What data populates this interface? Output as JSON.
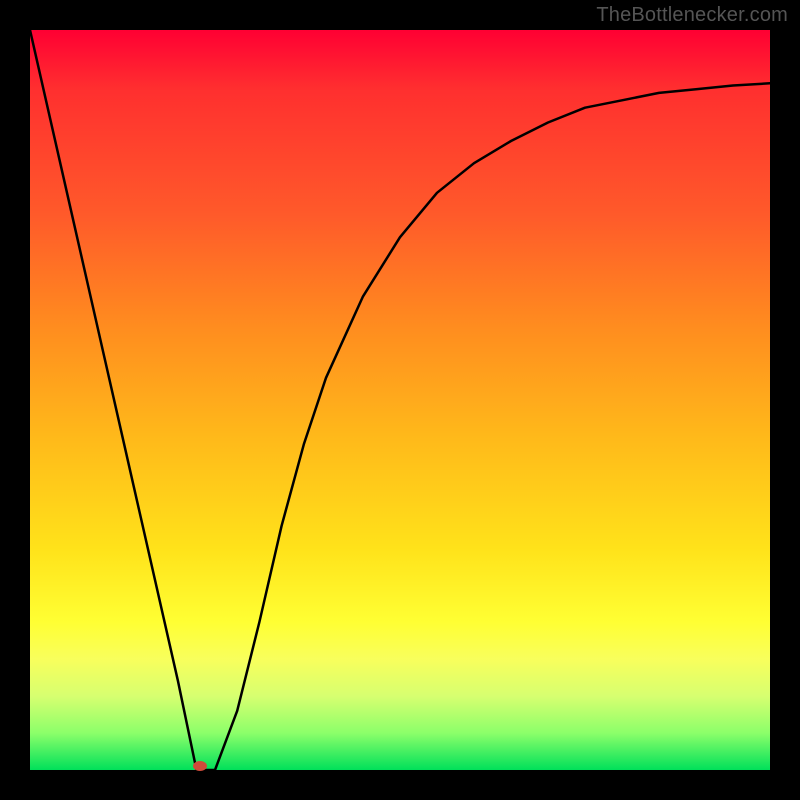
{
  "attribution": "TheBottlenecker.com",
  "colors": {
    "frame_bg": "#000000",
    "gradient_top": "#ff0033",
    "gradient_bottom": "#00e05a",
    "curve": "#000000",
    "marker": "#cf4b3a"
  },
  "chart_data": {
    "type": "line",
    "title": "",
    "xlabel": "",
    "ylabel": "",
    "xlim": [
      0,
      1
    ],
    "ylim": [
      0,
      1
    ],
    "series": [
      {
        "name": "curve",
        "x": [
          0.0,
          0.05,
          0.1,
          0.15,
          0.2,
          0.225,
          0.25,
          0.28,
          0.31,
          0.34,
          0.37,
          0.4,
          0.45,
          0.5,
          0.55,
          0.6,
          0.65,
          0.7,
          0.75,
          0.8,
          0.85,
          0.9,
          0.95,
          1.0
        ],
        "y": [
          1.0,
          0.78,
          0.56,
          0.34,
          0.12,
          0.0,
          0.0,
          0.08,
          0.2,
          0.33,
          0.44,
          0.53,
          0.64,
          0.72,
          0.78,
          0.82,
          0.85,
          0.875,
          0.895,
          0.905,
          0.915,
          0.92,
          0.925,
          0.928
        ]
      }
    ],
    "marker": {
      "x": 0.23,
      "y": 0.005
    },
    "note": "Axis values are normalized 0–1 (no tick labels shown in source image). y=0 at bottom (green), y=1 at top (red)."
  }
}
